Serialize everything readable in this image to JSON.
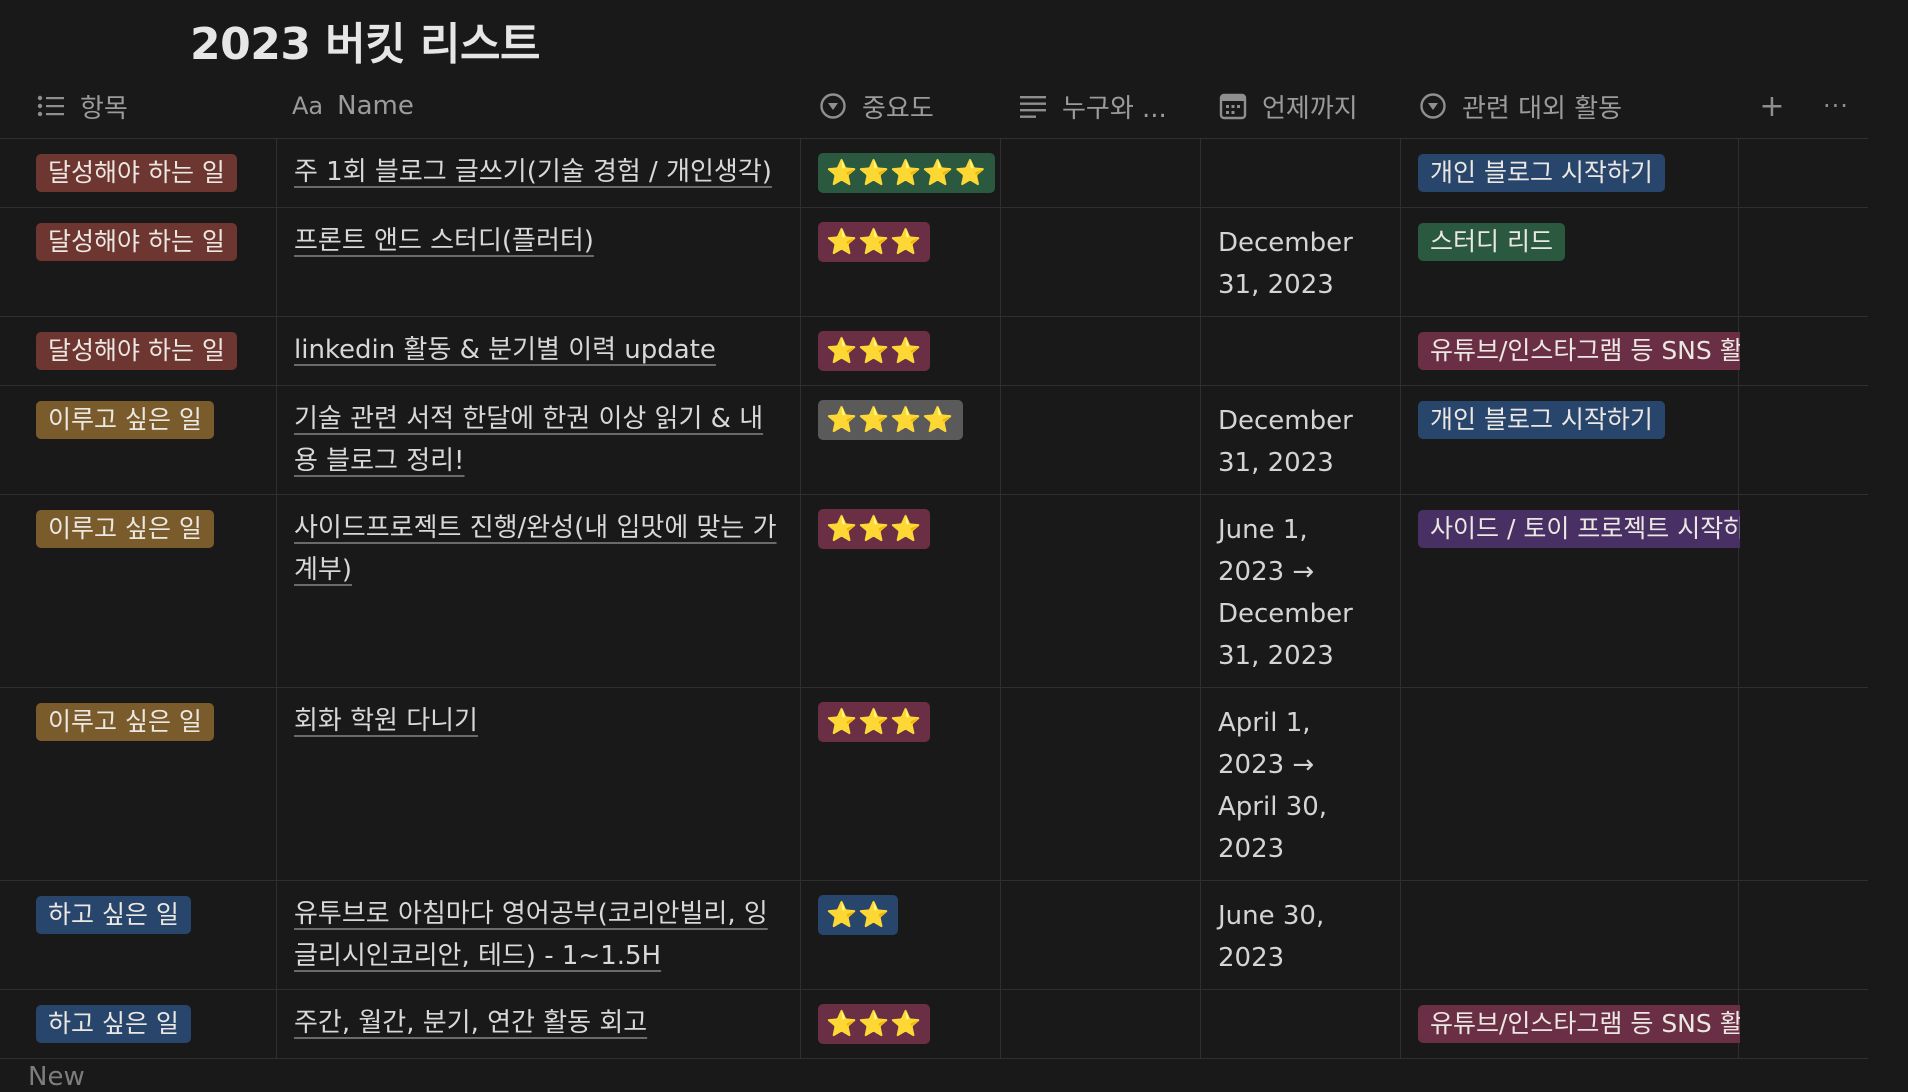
{
  "page": {
    "title": "2023 버킷 리스트",
    "new_label": "New"
  },
  "columns": {
    "category": "항목",
    "name_prefix": "Aa",
    "name": "Name",
    "importance": "중요도",
    "with": "누구와 ...",
    "deadline": "언제까지",
    "activity": "관련 대외 활동",
    "add": "+",
    "more": "···"
  },
  "icons": {
    "category": "list-icon",
    "importance": "select-icon",
    "with": "text-lines-icon",
    "deadline": "calendar-icon",
    "activity": "select-icon"
  },
  "colors": {
    "background": "#191919",
    "star": "#f4c53d",
    "tag_red": "#6e3630",
    "tag_brown": "#7a5b2c",
    "tag_blue": "#28456c",
    "tag_green": "#2b593f",
    "tag_gray": "#5a5a5a",
    "tag_rose": "#6a2f45",
    "tag_purple": "#493064"
  },
  "rows": [
    {
      "category": "달성해야 하는 일",
      "category_color": "red",
      "name_lines": [
        "주 1회 블로그 글쓰기(기술 경험 / 개인생각)"
      ],
      "stars": "⭐⭐⭐⭐⭐",
      "stars_color": "green",
      "deadline_lines": [],
      "activity": "개인 블로그 시작하기",
      "activity_color": "blue"
    },
    {
      "category": "달성해야 하는 일",
      "category_color": "red",
      "name_lines": [
        "프론트 앤드 스터디(플러터)"
      ],
      "stars": "⭐⭐⭐",
      "stars_color": "rose",
      "deadline_lines": [
        "December",
        "31, 2023"
      ],
      "activity": "스터디 리드",
      "activity_color": "green"
    },
    {
      "category": "달성해야 하는 일",
      "category_color": "red",
      "name_lines": [
        "linkedin 활동 & 분기별 이력 update"
      ],
      "stars": "⭐⭐⭐",
      "stars_color": "rose",
      "deadline_lines": [],
      "activity": "유튜브/인스타그램 등 SNS 활동",
      "activity_color": "rose"
    },
    {
      "category": "이루고 싶은 일",
      "category_color": "brown",
      "name_lines": [
        "기술 관련 서적 한달에 한권 이상 읽기 & 내",
        "용 블로그 정리!"
      ],
      "stars": "⭐⭐⭐⭐",
      "stars_color": "gray",
      "deadline_lines": [
        "December",
        "31, 2023"
      ],
      "activity": "개인 블로그 시작하기",
      "activity_color": "blue"
    },
    {
      "category": "이루고 싶은 일",
      "category_color": "brown",
      "name_lines": [
        "사이드프로젝트 진행/완성(내 입맛에 맞는 가",
        "계부)"
      ],
      "stars": "⭐⭐⭐",
      "stars_color": "rose",
      "deadline_lines": [
        "June 1,",
        "2023 →",
        "December",
        "31, 2023"
      ],
      "activity": "사이드 / 토이 프로젝트 시작하기",
      "activity_color": "purple"
    },
    {
      "category": "이루고 싶은 일",
      "category_color": "brown",
      "name_lines": [
        "회화 학원 다니기"
      ],
      "stars": "⭐⭐⭐",
      "stars_color": "rose",
      "deadline_lines": [
        "April 1,",
        "2023 →",
        "April 30,",
        "2023"
      ],
      "activity": "",
      "activity_color": ""
    },
    {
      "category": "하고 싶은 일",
      "category_color": "blue",
      "name_lines": [
        "유투브로 아침마다 영어공부(코리안빌리, 잉",
        "글리시인코리안, 테드) - 1~1.5H"
      ],
      "stars": "⭐⭐",
      "stars_color": "blue",
      "deadline_lines": [
        "June 30,",
        "2023"
      ],
      "activity": "",
      "activity_color": ""
    },
    {
      "category": "하고 싶은 일",
      "category_color": "blue",
      "name_lines": [
        "주간, 월간, 분기, 연간 활동 회고"
      ],
      "stars": "⭐⭐⭐",
      "stars_color": "rose",
      "deadline_lines": [],
      "activity": "유튜브/인스타그램 등 SNS 활동",
      "activity_color": "rose"
    }
  ]
}
